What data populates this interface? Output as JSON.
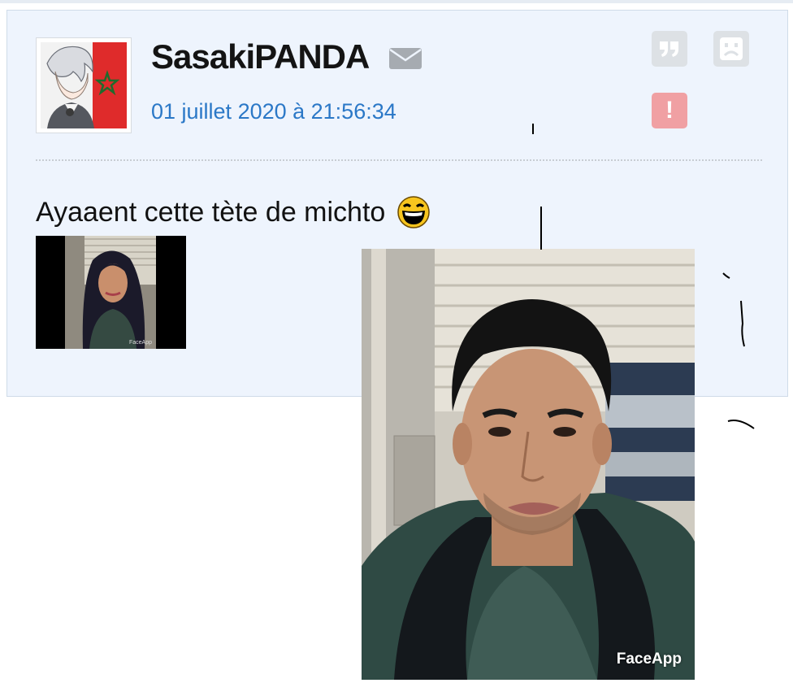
{
  "post": {
    "username": "SasakiPANDA",
    "timestamp": "01 juillet 2020 à 21:56:34",
    "message": "Ayaaent cette tète de michto",
    "icons": {
      "mail": "envelope-icon",
      "quote": "quote-icon",
      "sad": "sad-face-icon",
      "report": "exclamation-icon",
      "emoji": "laughing-emoji-icon"
    },
    "report_symbol": "!"
  },
  "thumbnail": {
    "watermark": "FaceApp"
  },
  "photo": {
    "watermark": "FaceApp"
  },
  "colors": {
    "card_bg": "#eef4fd",
    "card_border": "#cfdbe8",
    "timestamp": "#2b78c7",
    "report_btn": "#f0a0a3",
    "button_gray": "#dde1e5"
  }
}
